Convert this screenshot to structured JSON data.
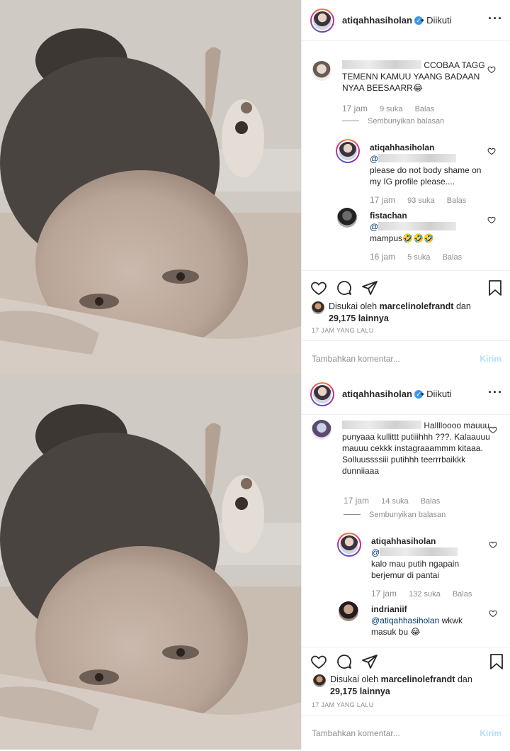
{
  "posts": [
    {
      "header": {
        "username": "atiqahhasiholan",
        "verified_icon": "✓",
        "follow_status": "• Diikuti",
        "more_icon": "···"
      },
      "comments": [
        {
          "text": "CCOBAA TAGG TEMENN KAMUU YAANG BADAAN NYAA BEESAARR😂",
          "time": "17 jam",
          "likes": "9 suka",
          "reply": "Balas",
          "hide": "Sembunyikan balasan"
        },
        {
          "username": "atiqahhasiholan",
          "mention": "@",
          "text": "please do not body shame on my IG profile please....",
          "time": "17 jam",
          "likes": "93 suka",
          "reply": "Balas"
        },
        {
          "username": "fistachan",
          "mention": "@",
          "text": "mampus🤣🤣🤣",
          "time": "16 jam",
          "likes": "5 suka",
          "reply": "Balas"
        }
      ],
      "liked_prefix": "Disukai oleh",
      "liked_user": "marcelinolefrandt",
      "liked_suffix": "dan",
      "liked_count": "29,175 lainnya",
      "ago": "17 JAM YANG LALU",
      "add_placeholder": "Tambahkan komentar...",
      "post_label": "Kirim"
    },
    {
      "header": {
        "username": "atiqahhasiholan",
        "verified_icon": "✓",
        "follow_status": "• Diikuti",
        "more_icon": "···"
      },
      "comments": [
        {
          "text": "Halllloooo mauuu punyaaa kullittt putiiihhh ???. Kalaauuu mauuu cekkk instagraaammm kitaaa. Solluussssiii putihhh teerrrbaikkk dunniiaaa",
          "time": "17 jam",
          "likes": "14 suka",
          "reply": "Balas",
          "hide": "Sembunyikan balasan"
        },
        {
          "username": "atiqahhasiholan",
          "mention": "@",
          "text": "kalo mau putih ngapain berjemur di pantai",
          "time": "17 jam",
          "likes": "132 suka",
          "reply": "Balas"
        },
        {
          "username": "indrianiif",
          "mention": "@atiqahhasiholan",
          "text": "wkwk masuk bu 😂"
        }
      ],
      "liked_prefix": "Disukai oleh",
      "liked_user": "marcelinolefrandt",
      "liked_suffix": "dan",
      "liked_count": "29,175 lainnya",
      "ago": "17 JAM YANG LALU",
      "add_placeholder": "Tambahkan komentar...",
      "post_label": "Kirim"
    }
  ],
  "colors": {
    "link": "#00376b",
    "muted": "#8e8e8e",
    "verified": "#3897f0",
    "post_disabled": "#b2dffc"
  }
}
